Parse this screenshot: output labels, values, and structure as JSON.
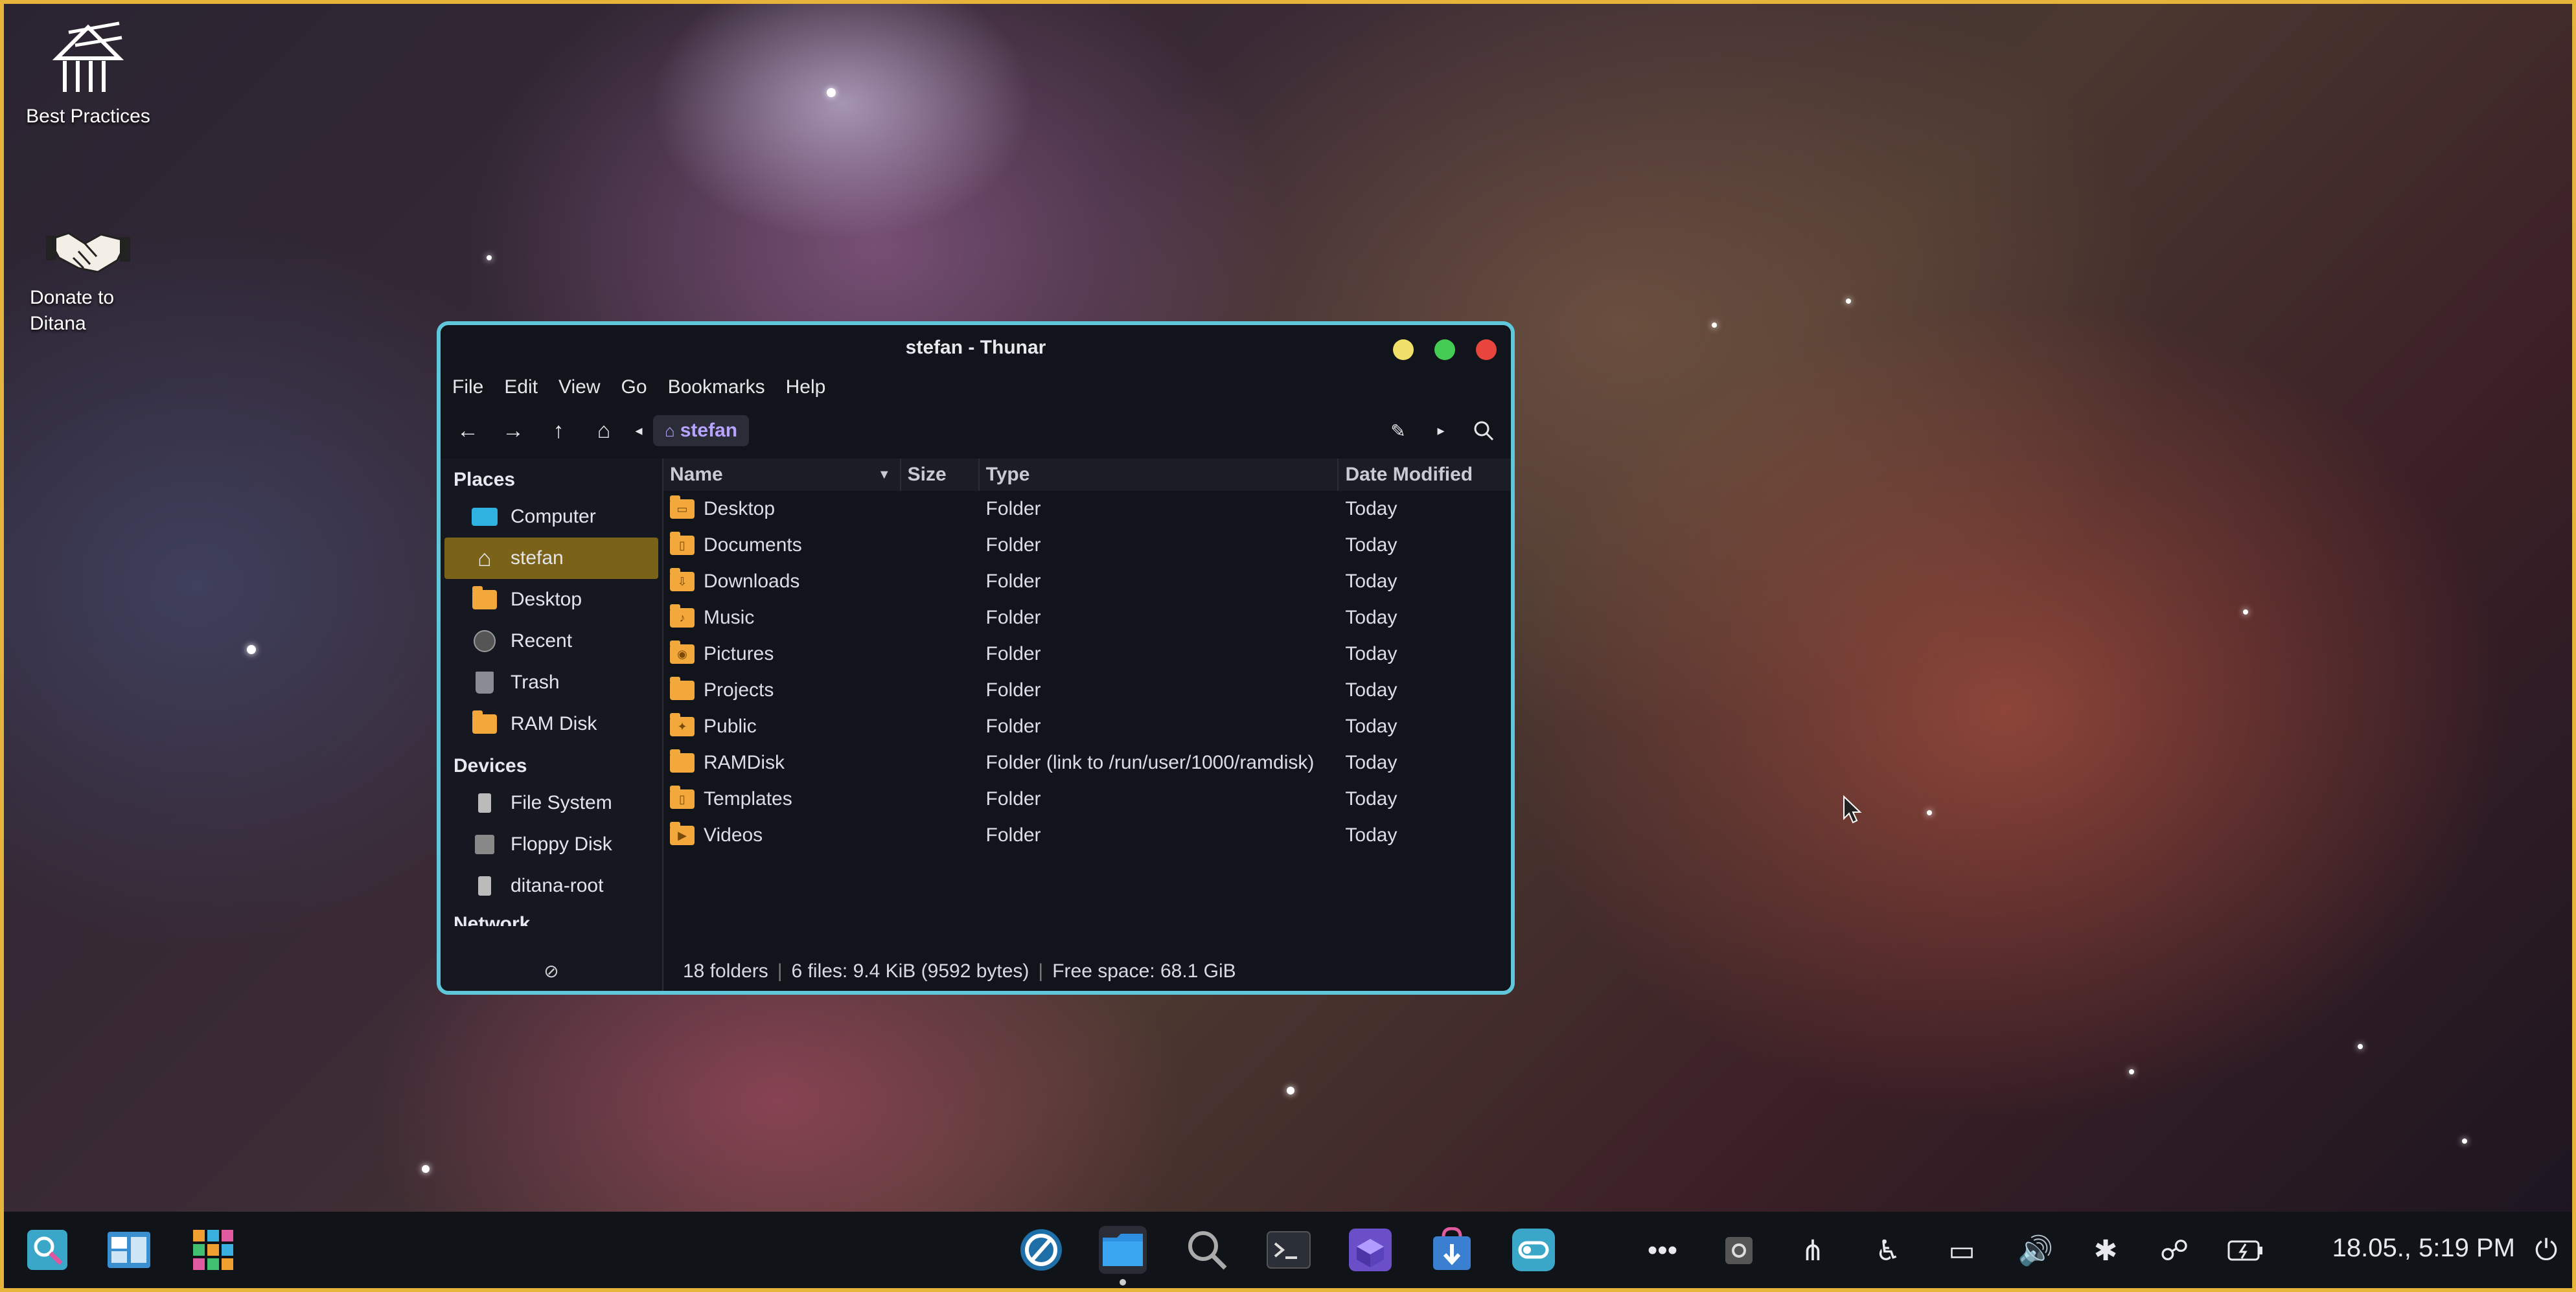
{
  "desktop": {
    "icons": [
      {
        "label": "Best Practices"
      },
      {
        "label": "Donate to Ditana"
      }
    ]
  },
  "window": {
    "title": "stefan - Thunar",
    "menu": [
      "File",
      "Edit",
      "View",
      "Go",
      "Bookmarks",
      "Help"
    ],
    "breadcrumb": "stefan",
    "sidebar": {
      "places_header": "Places",
      "places": [
        {
          "label": "Computer",
          "icon": "computer-icon"
        },
        {
          "label": "stefan",
          "icon": "home-icon"
        },
        {
          "label": "Desktop",
          "icon": "desktop-folder-icon"
        },
        {
          "label": "Recent",
          "icon": "clock-icon"
        },
        {
          "label": "Trash",
          "icon": "trash-icon"
        },
        {
          "label": "RAM Disk",
          "icon": "folder-icon"
        }
      ],
      "devices_header": "Devices",
      "devices": [
        {
          "label": "File System",
          "icon": "drive-icon"
        },
        {
          "label": "Floppy Disk",
          "icon": "floppy-icon"
        },
        {
          "label": "ditana-root",
          "icon": "drive-icon"
        }
      ],
      "network_header": "Network"
    },
    "columns": {
      "name": "Name",
      "size": "Size",
      "type": "Type",
      "date": "Date Modified"
    },
    "files": [
      {
        "name": "Desktop",
        "type": "Folder",
        "date": "Today"
      },
      {
        "name": "Documents",
        "type": "Folder",
        "date": "Today"
      },
      {
        "name": "Downloads",
        "type": "Folder",
        "date": "Today"
      },
      {
        "name": "Music",
        "type": "Folder",
        "date": "Today"
      },
      {
        "name": "Pictures",
        "type": "Folder",
        "date": "Today"
      },
      {
        "name": "Projects",
        "type": "Folder",
        "date": "Today"
      },
      {
        "name": "Public",
        "type": "Folder",
        "date": "Today"
      },
      {
        "name": "RAMDisk",
        "type": "Folder (link to /run/user/1000/ramdisk)",
        "date": "Today"
      },
      {
        "name": "Templates",
        "type": "Folder",
        "date": "Today"
      },
      {
        "name": "Videos",
        "type": "Folder",
        "date": "Today"
      }
    ],
    "status": {
      "folders": "18 folders",
      "files": "6 files: 9.4 KiB (9592 bytes)",
      "free": "Free space: 68.1 GiB"
    }
  },
  "taskbar": {
    "clock": "18.05., 5:19 PM"
  },
  "colors": {
    "accent_border": "#5fc7d9",
    "selection": "#7a6318",
    "folder": "#f2a83b",
    "breadcrumb": "#b8a3ff"
  }
}
